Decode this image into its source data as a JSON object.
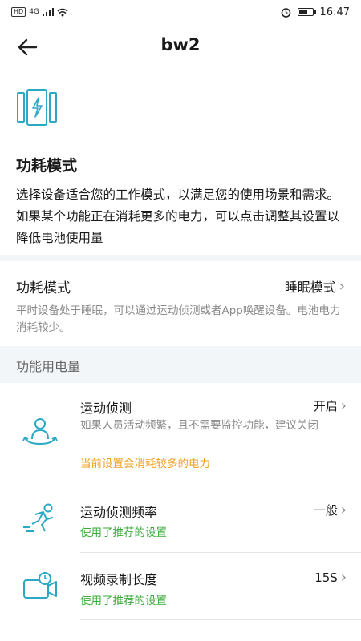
{
  "status_bar": {
    "network": "4G",
    "hd": "HD",
    "time": "16:47"
  },
  "header": {
    "title": "bw2"
  },
  "intro": {
    "title": "功耗模式",
    "description": "选择设备适合您的工作模式，以满足您的使用场景和需求。如果某个功能正在消耗更多的电力，可以点击调整其设置以降低电池使用量"
  },
  "power_mode": {
    "label": "功耗模式",
    "value": "睡眠模式",
    "description": "平时设备处于睡眠，可以通过运动侦测或者App唤醒设备。电池电力消耗较少。"
  },
  "usage": {
    "title": "功能用电量",
    "items": [
      {
        "name": "运动侦测",
        "value": "开启",
        "description": "如果人员活动频繁，且不需要监控功能，建议关闭",
        "note": "当前设置会消耗较多的电力",
        "icon": "person-motion-icon"
      },
      {
        "name": "运动侦测频率",
        "value": "一般",
        "note": "使用了推荐的设置",
        "icon": "running-person-icon"
      },
      {
        "name": "视频录制长度",
        "value": "15S",
        "note": "使用了推荐的设置",
        "icon": "video-camera-clock-icon"
      }
    ]
  },
  "colors": {
    "accent": "#2aa8c4",
    "warning": "#f0a020",
    "ok": "#3aab3a",
    "band": "#f3f6f9"
  }
}
